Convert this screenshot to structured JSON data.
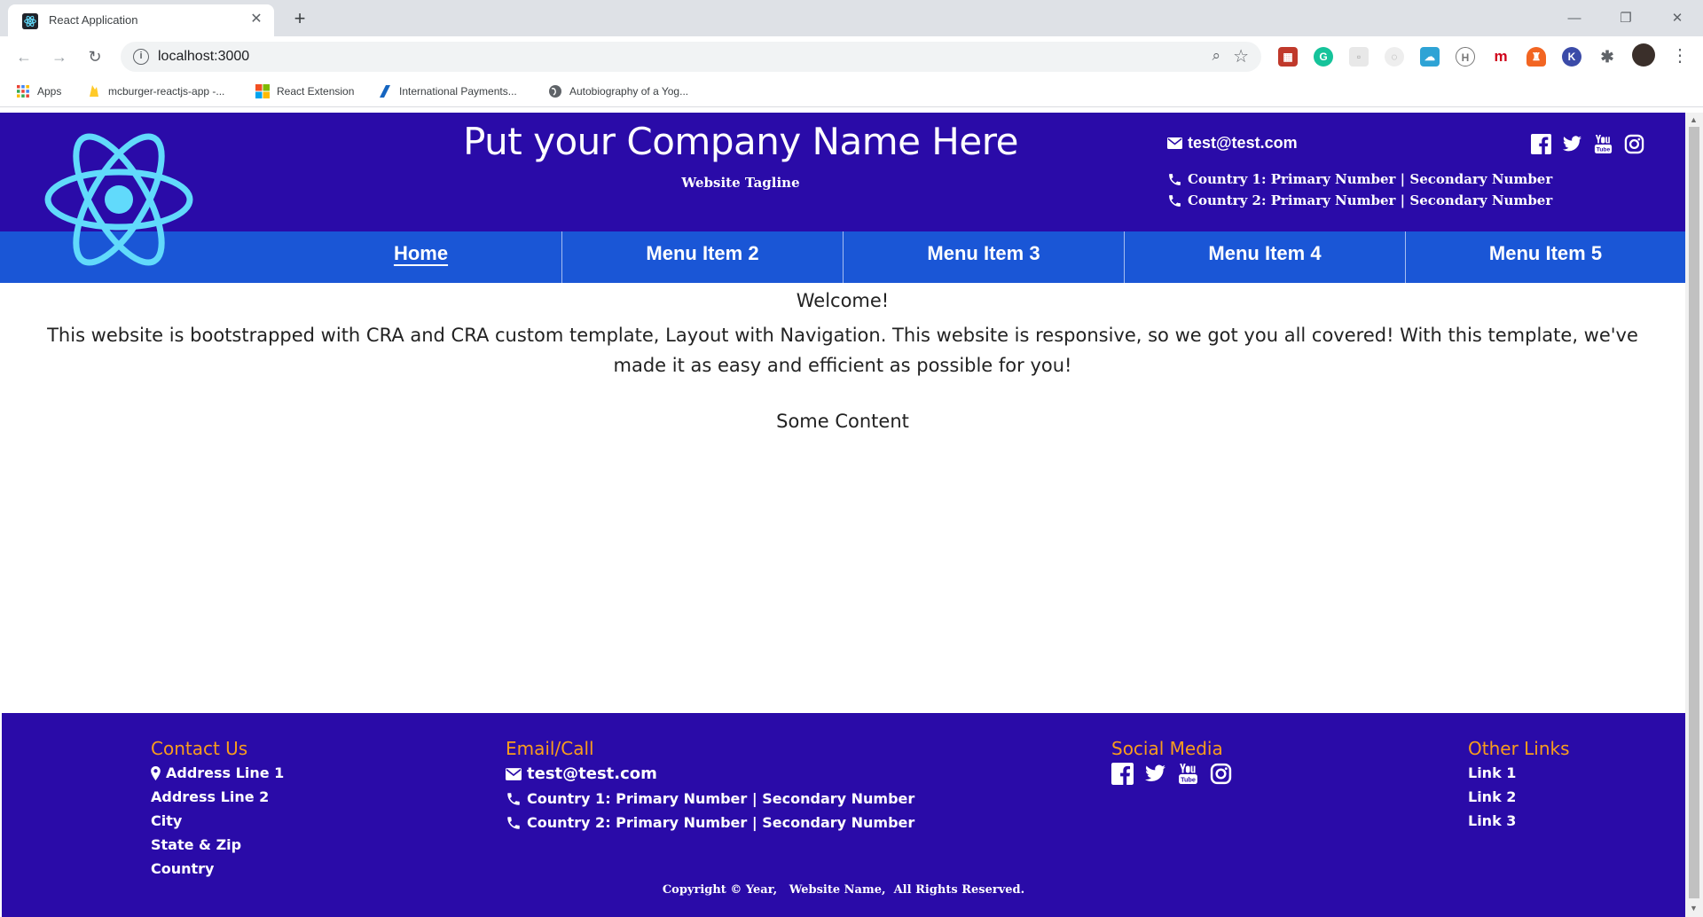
{
  "browser": {
    "tab_title": "React Application",
    "url": "localhost:3000",
    "bookmarks": [
      {
        "label": "Apps"
      },
      {
        "label": "mcburger-reactjs-app -..."
      },
      {
        "label": "React Extension"
      },
      {
        "label": "International Payments..."
      },
      {
        "label": "Autobiography of a Yog..."
      }
    ]
  },
  "header": {
    "company_name": "Put your Company Name Here",
    "tagline": "Website Tagline",
    "email": "test@test.com",
    "phones": [
      "Country 1: Primary Number | Secondary Number",
      "Country 2: Primary Number | Secondary Number"
    ],
    "social": [
      "facebook-icon",
      "twitter-icon",
      "youtube-icon",
      "instagram-icon"
    ]
  },
  "nav": {
    "items": [
      "Home",
      "Menu Item 2",
      "Menu Item 3",
      "Menu Item 4",
      "Menu Item 5"
    ],
    "active": "Home"
  },
  "main": {
    "welcome": "Welcome!",
    "intro": "This website is bootstrapped with CRA and CRA custom template, Layout with Navigation. This website is responsive, so we got you all covered! With this template, we've made it as easy and efficient as possible for you!",
    "content": "Some Content"
  },
  "footer": {
    "contact": {
      "heading": "Contact Us",
      "lines": [
        "Address Line 1",
        "Address Line 2",
        "City",
        "State & Zip",
        "Country"
      ]
    },
    "email_call": {
      "heading": "Email/Call",
      "email": "test@test.com",
      "phones": [
        "Country 1: Primary Number | Secondary Number",
        "Country 2: Primary Number | Secondary Number"
      ]
    },
    "social": {
      "heading": "Social Media"
    },
    "links": {
      "heading": "Other Links",
      "items": [
        "Link 1",
        "Link 2",
        "Link 3"
      ]
    },
    "copyright": "Copyright © Year,   Website Name,  All Rights Reserved."
  },
  "colors": {
    "header_bg": "#2a0ba8",
    "nav_bg": "#1a56d6",
    "footer_heading": "#f99d1c",
    "logo": "#61dafb"
  }
}
